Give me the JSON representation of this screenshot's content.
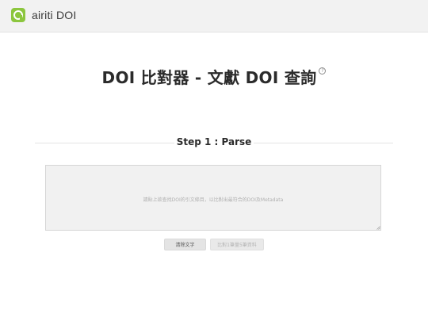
{
  "header": {
    "logo_text": "airiti DOI"
  },
  "main": {
    "title": "DOI 比對器 - 文獻 DOI 查詢",
    "help_glyph": "?",
    "step_label": "Step 1 : Parse",
    "input": {
      "value": "",
      "placeholder": "請貼上欲查找DOI的引文條目，以比對出最符合的DOI及Metadata"
    },
    "buttons": {
      "clear_label": "清除文字",
      "compare_label": "比對1筆量5筆資料"
    }
  },
  "colors": {
    "brand_green": "#8cc63e",
    "header_bg": "#f2f2f2",
    "text_dark": "#2b2b2b"
  }
}
